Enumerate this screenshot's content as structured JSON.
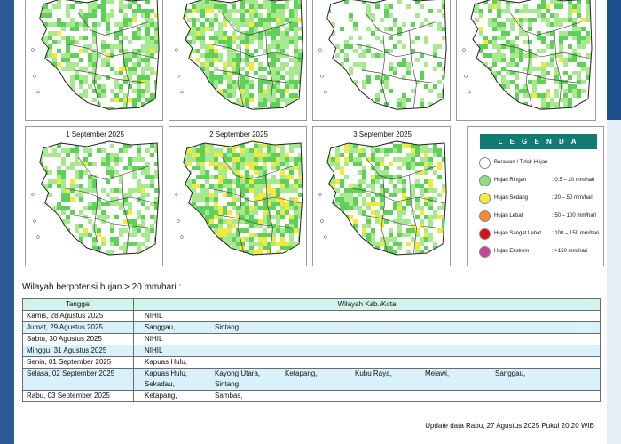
{
  "maps": {
    "top_row": [
      {
        "id": "map-28-aug",
        "date": ""
      },
      {
        "id": "map-29-aug",
        "date": ""
      },
      {
        "id": "map-30-aug",
        "date": ""
      },
      {
        "id": "map-31-aug",
        "date": ""
      }
    ],
    "bottom_row": [
      {
        "id": "map-01-sep",
        "date": "1 September 2025"
      },
      {
        "id": "map-02-sep",
        "date": "2 September 2025"
      },
      {
        "id": "map-03-sep",
        "date": "3 September 2025"
      }
    ]
  },
  "legend": {
    "title": "L E G E N D A",
    "items": [
      {
        "label": "Berawan / Tidak Hujan",
        "range": "",
        "color": "#ffffff"
      },
      {
        "label": "Hujan Ringan",
        "range": ": 0.5 – 20 mm/hari",
        "color": "#8fe07a"
      },
      {
        "label": "Hujan Sedang",
        "range": ": 20 – 50 mm/hari",
        "color": "#f4ec3a"
      },
      {
        "label": "Hujan Lebat",
        "range": ": 50 – 100 mm/hari",
        "color": "#ef8f2f"
      },
      {
        "label": "Hujan Sangat Lebat",
        "range": ": 100 – 150 mm/hari",
        "color": "#d41414"
      },
      {
        "label": "Hujan Ekstrem",
        "range": ": >150 mm/hari",
        "color": "#c9459c"
      }
    ]
  },
  "section_title": "Wilayah berpotensi hujan > 20 mm/hari :",
  "table": {
    "headers": [
      "Tanggal",
      "Wilayah Kab./Kota"
    ],
    "rows": [
      {
        "date": "Kamis, 28 Agustus 2025",
        "places": [
          "NIHIL"
        ]
      },
      {
        "date": "Jumat, 29 Agustus 2025",
        "places": [
          "Sanggau,",
          "Sintang,"
        ]
      },
      {
        "date": "Sabtu, 30 Agustus 2025",
        "places": [
          "NIHIL"
        ]
      },
      {
        "date": "Minggu, 31 Agustus 2025",
        "places": [
          "NIHIL"
        ]
      },
      {
        "date": "Senin, 01 September 2025",
        "places": [
          "Kapuas Hulu,"
        ]
      },
      {
        "date": "Selasa, 02 September 2025",
        "places": [
          "Kapuas Hulu,",
          "Kayong Utara,",
          "Ketapang,",
          "Kubu Raya,",
          "Melawi,",
          "Sanggau,",
          "Sekadau,",
          "Sintang,"
        ]
      },
      {
        "date": "Rabu, 03 September 2025",
        "places": [
          "Ketapang,",
          "Sambas,"
        ]
      }
    ]
  },
  "update_text": "Update data Rabu, 27 Agustus 2025 Pukul 20.20 WIB"
}
